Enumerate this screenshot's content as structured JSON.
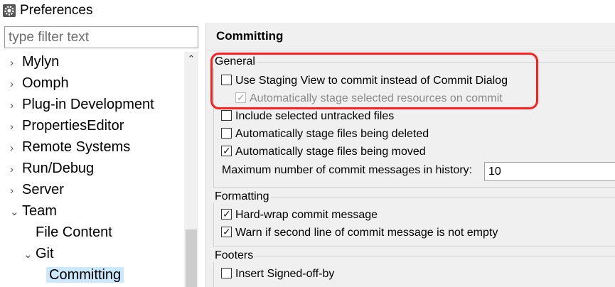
{
  "window": {
    "title": "Preferences",
    "icon": "preferences-gear-icon"
  },
  "filter": {
    "placeholder": "type filter text",
    "value": ""
  },
  "tree": {
    "items": [
      {
        "label": "Mylyn",
        "chevron": "›"
      },
      {
        "label": "Oomph",
        "chevron": "›"
      },
      {
        "label": "Plug-in Development",
        "chevron": "›"
      },
      {
        "label": "PropertiesEditor",
        "chevron": "›"
      },
      {
        "label": "Remote Systems",
        "chevron": "›"
      },
      {
        "label": "Run/Debug",
        "chevron": "›"
      },
      {
        "label": "Server",
        "chevron": "›"
      },
      {
        "label": "Team",
        "chevron": "⌄"
      },
      {
        "label": "File Content",
        "chevron": ""
      },
      {
        "label": "Git",
        "chevron": "⌄"
      },
      {
        "label": "Committing",
        "chevron": ""
      }
    ]
  },
  "page": {
    "title": "Committing",
    "general": {
      "label": "General",
      "options": [
        {
          "label": "Use Staging View to commit instead of Commit Dialog",
          "checked": false
        },
        {
          "label": "Automatically stage selected resources on commit",
          "checked": true,
          "disabled": true
        },
        {
          "label": "Include selected untracked files",
          "checked": false
        },
        {
          "label": "Automatically stage files being deleted",
          "checked": false
        },
        {
          "label": "Automatically stage files being moved",
          "checked": true
        }
      ],
      "max_messages_label": "Maximum number of commit messages in history:",
      "max_messages_value": "10"
    },
    "formatting": {
      "label": "Formatting",
      "options": [
        {
          "label": "Hard-wrap commit message",
          "checked": true
        },
        {
          "label": "Warn if second line of commit message is not empty",
          "checked": true
        }
      ]
    },
    "footers": {
      "label": "Footers",
      "options": [
        {
          "label": "Insert Signed-off-by",
          "checked": false
        }
      ]
    }
  },
  "colors": {
    "highlight": "#ff1f1f",
    "selection": "#cce8ff",
    "panel": "#f0f0f0"
  }
}
